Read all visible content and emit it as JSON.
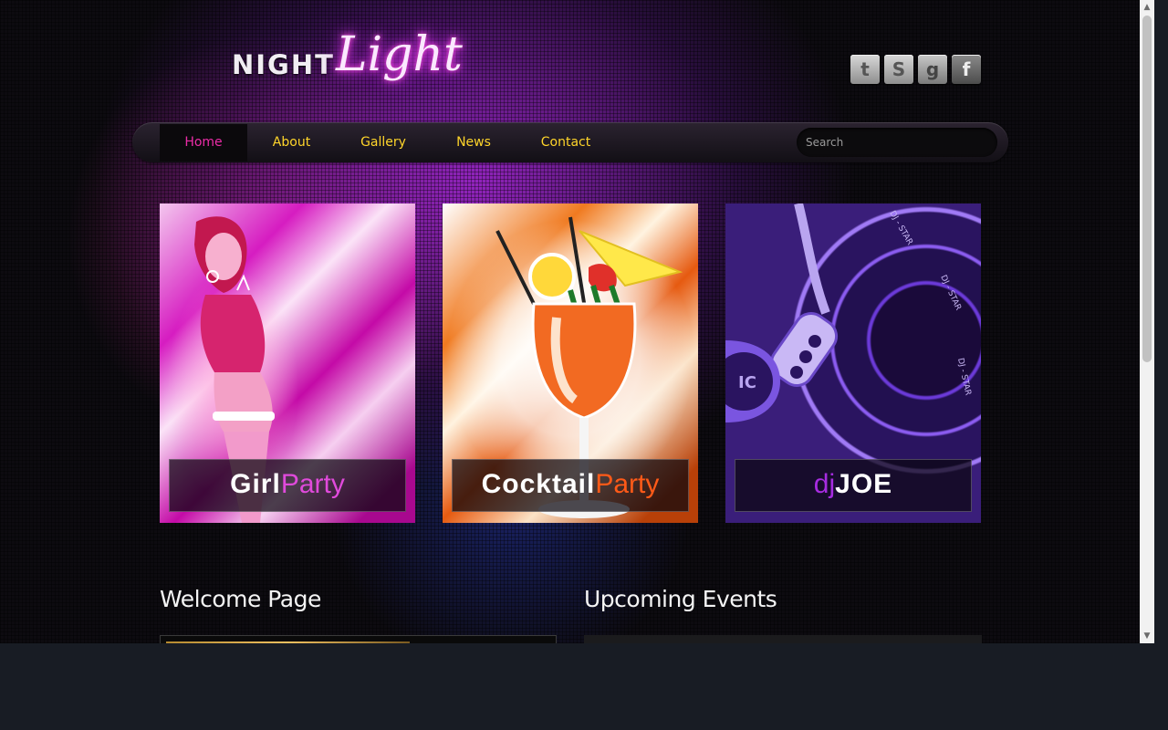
{
  "logo": {
    "part1": "NIGHT",
    "part2": "Light"
  },
  "social": [
    {
      "icon": "twitter-icon",
      "glyph": "t"
    },
    {
      "icon": "skype-icon",
      "glyph": "S"
    },
    {
      "icon": "google-icon",
      "glyph": "g"
    },
    {
      "icon": "facebook-icon",
      "glyph": "f"
    }
  ],
  "nav": {
    "items": [
      {
        "label": "Home",
        "active": true
      },
      {
        "label": "About"
      },
      {
        "label": "Gallery"
      },
      {
        "label": "News"
      },
      {
        "label": "Contact"
      }
    ],
    "search_placeholder": "Search"
  },
  "cards": [
    {
      "strong": "Girl",
      "thin": "Party"
    },
    {
      "strong": "Cocktail",
      "thin": "Party"
    },
    {
      "thin": "dj",
      "strong": "JOE",
      "decor": [
        "DJ - STAR",
        "DJ - STAR",
        "DJ - STAR",
        "IC"
      ]
    }
  ],
  "sections": {
    "welcome": "Welcome Page",
    "events": "Upcoming Events"
  },
  "colors": {
    "nav_text": "#ffd52a",
    "nav_active": "#ec2ca8",
    "accent_pink": "#e04adb",
    "accent_orange": "#ff5a18",
    "accent_purple": "#a62ce0"
  }
}
